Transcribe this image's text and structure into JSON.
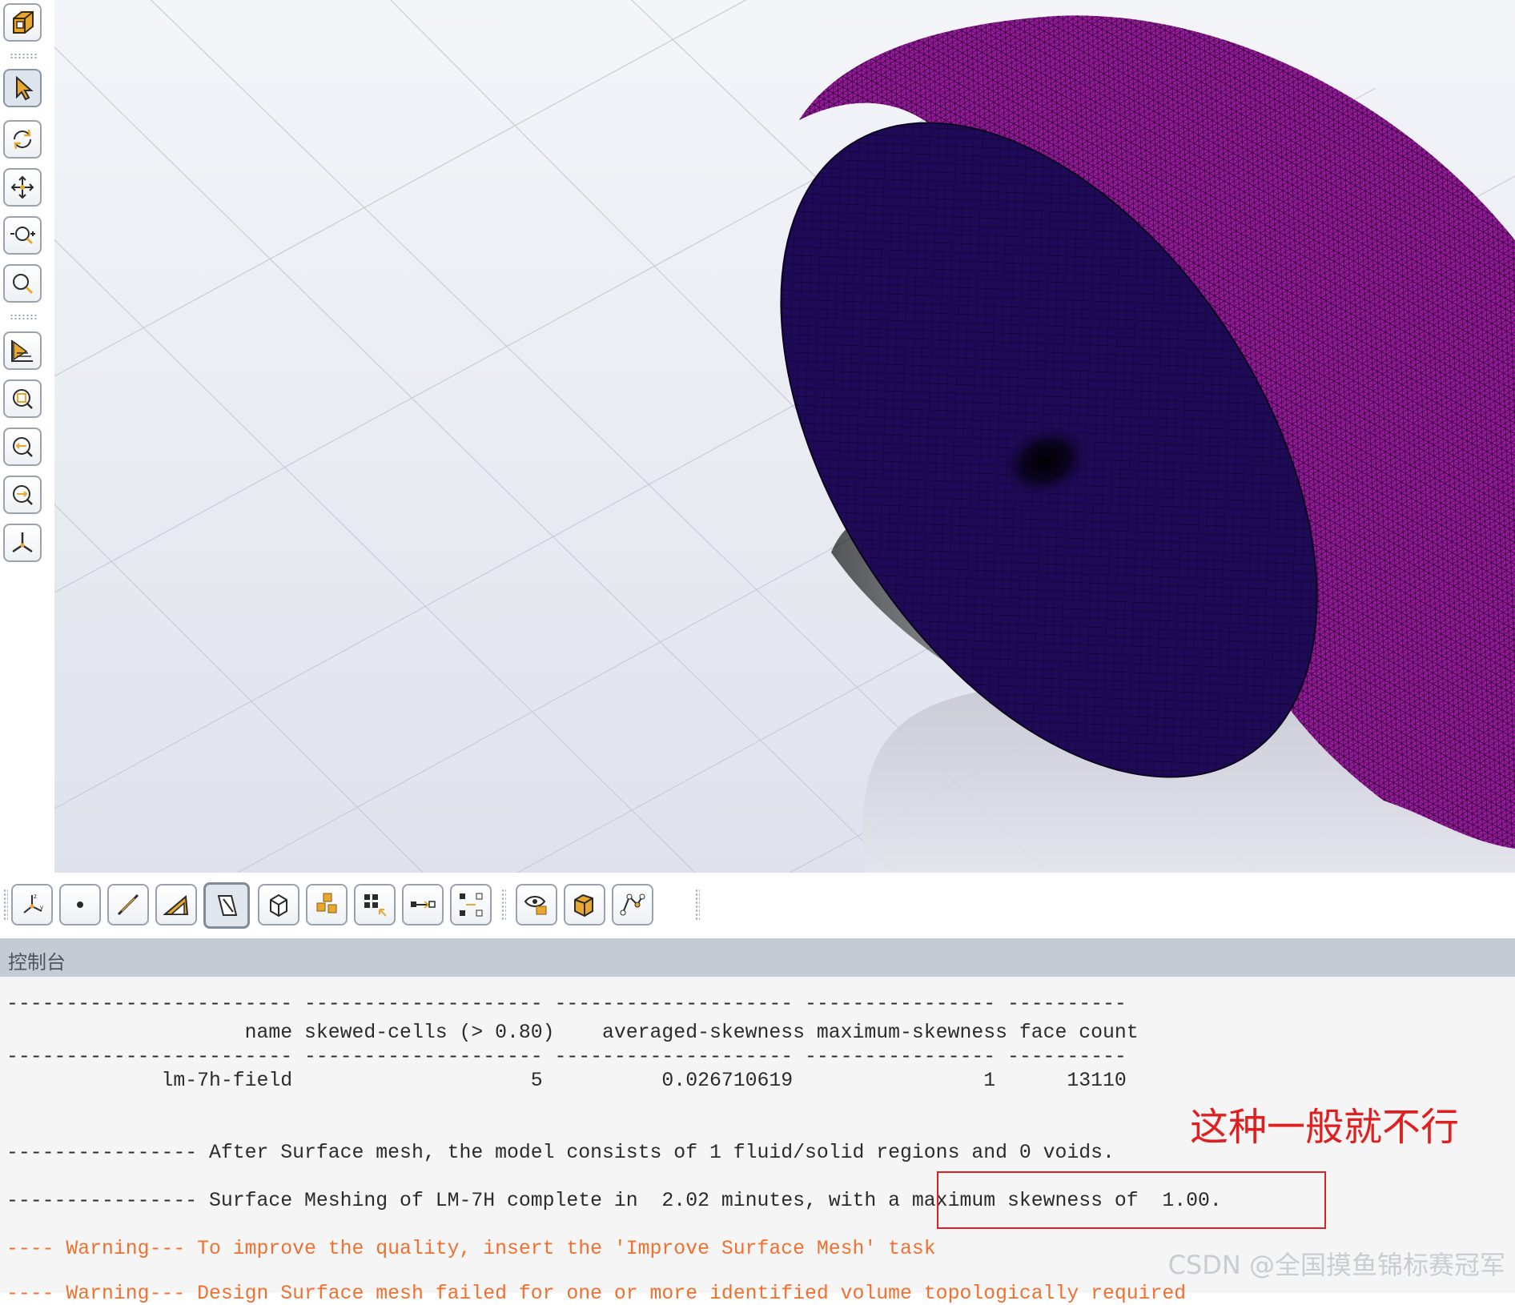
{
  "left_toolbar": {
    "items": [
      "view-cube-icon",
      "select-arrow-icon",
      "rotate-icon",
      "pan-icon",
      "zoom-in-out-icon",
      "zoom-icon",
      "display-icon",
      "zoom-to-fit-icon",
      "zoom-out-icon",
      "zoom-extent-icon",
      "axes-icon"
    ]
  },
  "bottom_toolbar": {
    "items": [
      "axis-filter-icon",
      "point-select-icon",
      "edge-select-icon",
      "face-select-icon",
      "surface-select-icon",
      "body-select-icon",
      "multi-body-select-icon",
      "box-select-icon",
      "connect-icon",
      "distribute-icon",
      "hide-icon",
      "show-body-icon",
      "mesh-nodes-icon"
    ]
  },
  "viewport": {
    "model_colors": {
      "cut_face": "#1f0a58",
      "outer_surface": "#9a1a9e",
      "mesh_line": "#0f0530"
    }
  },
  "console": {
    "title": "控制台",
    "lines": [
      "------------------------ -------------------- -------------------- ---------------- ----------",
      "                    name skewed-cells (> 0.80)    averaged-skewness maximum-skewness face count",
      "------------------------ -------------------- -------------------- ---------------- ----------",
      "             lm-7h-field                    5          0.026710619                1      13110",
      "",
      "---------------- After Surface mesh, the model consists of 1 fluid/solid regions and 0 voids.",
      "",
      "---------------- Surface Meshing of LM-7H complete in  2.02 minutes, with a maximum skewness of  1.00.",
      "",
      "---- Warning--- To improve the quality, insert the 'Improve Surface Mesh' task",
      "---- Warning--- Design Surface mesh failed for one or more identified volume topologically required"
    ],
    "warning_color": "#f07030"
  },
  "annotation": {
    "note": "这种一般就不行",
    "color": "#e02020"
  },
  "watermark": "CSDN @全国摸鱼锦标赛冠军"
}
